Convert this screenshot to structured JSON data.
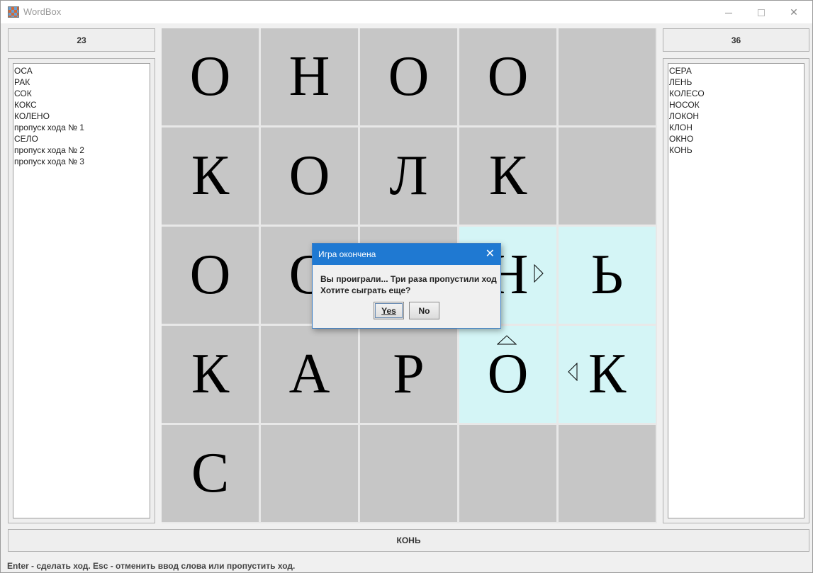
{
  "window": {
    "title": "WordBox"
  },
  "scores": {
    "left": "23",
    "right": "36"
  },
  "left_list": [
    "ОСА",
    "РАК",
    "СОК",
    "КОКС",
    "КОЛЕНО",
    "пропуск хода № 1",
    "СЕЛО",
    "пропуск хода № 2",
    "пропуск хода № 3"
  ],
  "right_list": [
    "СЕРА",
    "ЛЕНЬ",
    "КОЛЕСО",
    "НОСОК",
    "ЛОКОН",
    "КЛОН",
    "ОКНО",
    "КОНЬ"
  ],
  "grid": {
    "rows": [
      [
        "О",
        "Н",
        "О",
        "О",
        ""
      ],
      [
        "К",
        "О",
        "Л",
        "К",
        ""
      ],
      [
        "О",
        "О",
        "",
        "Н",
        "Ь"
      ],
      [
        "К",
        "А",
        "Р",
        "О",
        "К"
      ],
      [
        "С",
        "",
        "",
        "",
        ""
      ]
    ],
    "highlight_color": "#d4f5f6",
    "cell_color": "#c6c6c6"
  },
  "current_word": "КОНЬ",
  "status_text": "Enter - сделать ход. Esc - отменить ввод слова или пропустить ход.",
  "dialog": {
    "title": "Игра окончена",
    "line1": "Вы проиграли... Три раза пропустили ход",
    "line2": "Хотите сыграть еще?",
    "yes_label": "Yes",
    "no_label": "No"
  }
}
